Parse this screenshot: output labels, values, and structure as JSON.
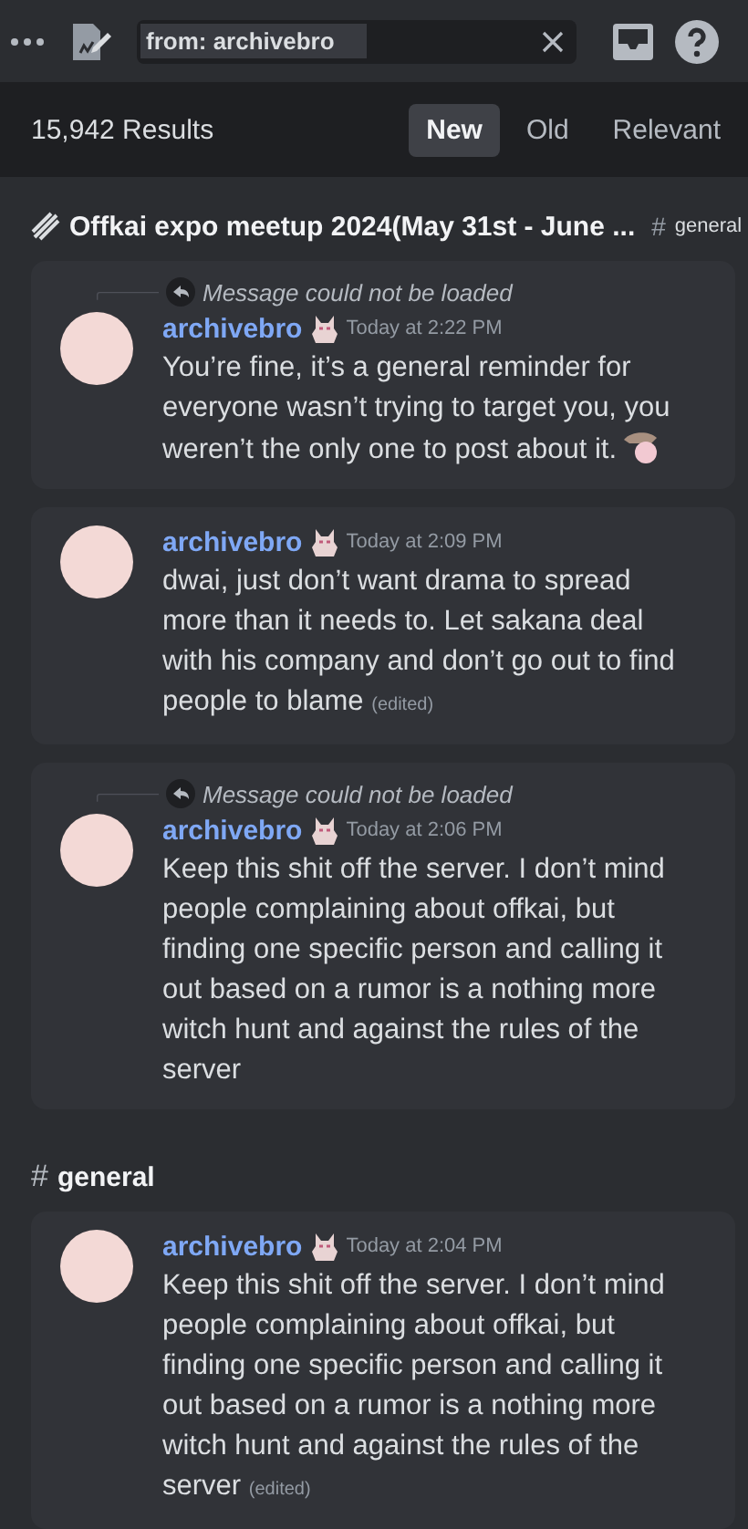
{
  "toolbar": {
    "search": {
      "value": "from: archivebro"
    }
  },
  "results": {
    "count": "15,942 Results",
    "sort_tabs": [
      {
        "label": "New",
        "selected": true
      },
      {
        "label": "Old",
        "selected": false
      },
      {
        "label": "Relevant",
        "selected": false
      }
    ]
  },
  "groups": [
    {
      "kind": "thread",
      "title": "Offkai expo meetup 2024(May 31st - June ...",
      "channel_hash": "#",
      "channel": "general",
      "messages": [
        {
          "reply": "Message could not be loaded",
          "author": "archivebro",
          "time": "Today at 2:22 PM",
          "text": "You’re fine, it’s a general reminder for everyone wasn’t trying to target you, you weren’t the only one to post about it.",
          "emoji": true
        },
        {
          "author": "archivebro",
          "time": "Today at 2:09 PM",
          "text": "dwai, just don’t want drama to spread more than it needs to. Let sakana deal with his company and don’t go out to find people to blame",
          "edited": "(edited)"
        },
        {
          "reply": "Message could not be loaded",
          "author": "archivebro",
          "time": "Today at 2:06 PM",
          "text": "Keep this shit off the server. I don’t mind people complaining about offkai, but finding one specific person and calling it out based on a rumor is a nothing more witch hunt and against the rules of the server"
        }
      ]
    },
    {
      "kind": "channel",
      "channel_hash": "#",
      "channel": "general",
      "messages": [
        {
          "author": "archivebro",
          "time": "Today at 2:04 PM",
          "text": "Keep this shit off the server. I don’t mind people complaining about offkai, but finding one specific person and calling it out based on a rumor is a nothing more witch hunt and against the rules of the server",
          "edited": "(edited)"
        }
      ]
    }
  ]
}
